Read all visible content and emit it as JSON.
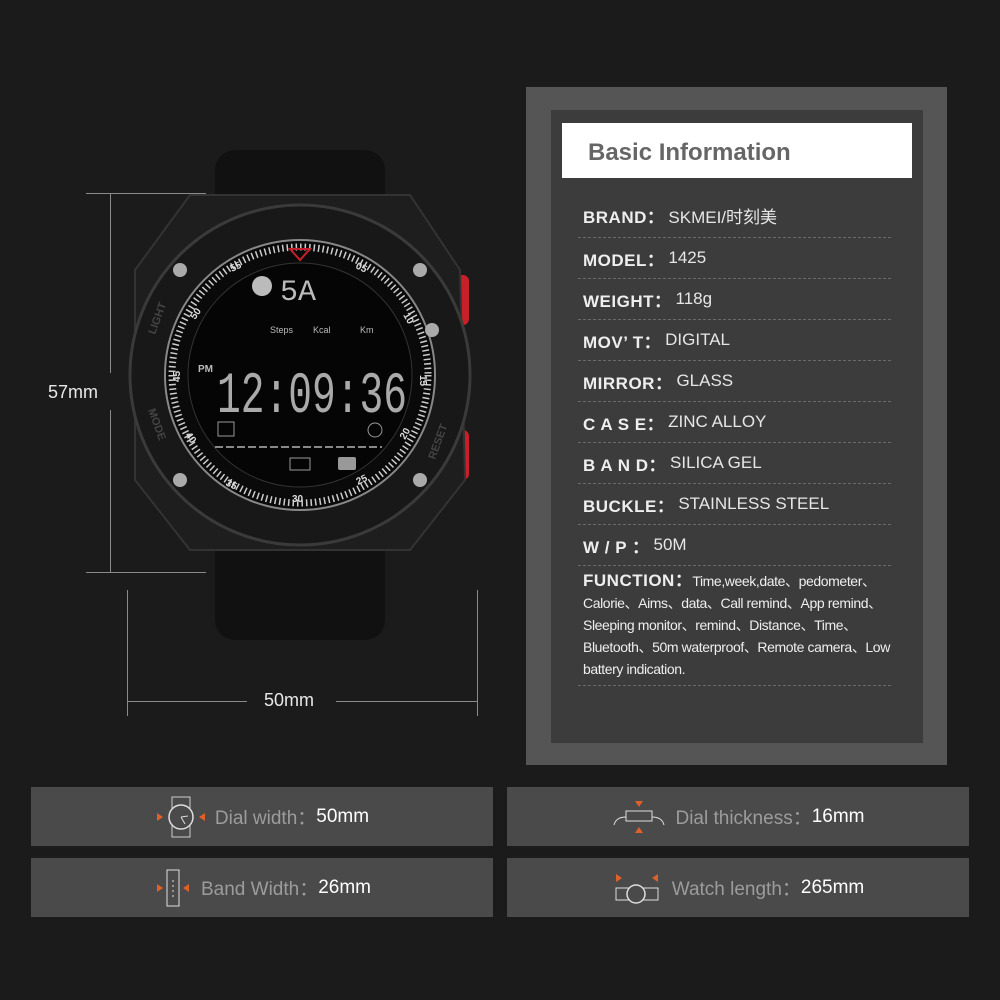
{
  "dimensions": {
    "height": "57mm",
    "width": "50mm"
  },
  "watch": {
    "top_display": "5A",
    "labels": [
      "Steps",
      "Kcal",
      "Km"
    ],
    "ampm": "PM",
    "time": "12:09:36",
    "bezel_numbers": [
      "55",
      "05",
      "10",
      "15",
      "20",
      "25",
      "30",
      "35",
      "40",
      "45",
      "50"
    ],
    "button_labels": {
      "light": "LIGHT",
      "mode": "MODE",
      "reset": "RESET"
    },
    "accent_color": "#c8202a"
  },
  "panel": {
    "title": "Basic Information",
    "rows": [
      {
        "key": "BRAND：",
        "value": "SKMEI/时刻美"
      },
      {
        "key": "MODEL：",
        "value": "1425"
      },
      {
        "key": "WEIGHT：",
        "value": "118g"
      },
      {
        "key": "MOV’ T：",
        "value": "DIGITAL"
      },
      {
        "key": "MIRROR：",
        "value": "GLASS"
      },
      {
        "key": "C A S E：",
        "value": "ZINC ALLOY"
      },
      {
        "key": "B A N D：",
        "value": "SILICA GEL"
      },
      {
        "key": "BUCKLE：",
        "value": "STAINLESS STEEL"
      },
      {
        "key": "W / P ：",
        "value": "50M"
      }
    ],
    "function": {
      "key": "FUNCTION：",
      "value": "Time,week,date、pedometer、Calorie、Aims、data、Call remind、App remind、Sleeping monitor、remind、Distance、Time、Bluetooth、50m waterproof、Remote camera、Low battery indication."
    }
  },
  "specs": [
    {
      "icon": "dial-width-icon",
      "label": "Dial width：",
      "value": "50mm"
    },
    {
      "icon": "dial-thickness-icon",
      "label": "Dial thickness：",
      "value": "16mm"
    },
    {
      "icon": "band-width-icon",
      "label": "Band Width：",
      "value": "26mm"
    },
    {
      "icon": "watch-length-icon",
      "label": "Watch length：",
      "value": "265mm"
    }
  ],
  "icon_accent": "#e0602a"
}
